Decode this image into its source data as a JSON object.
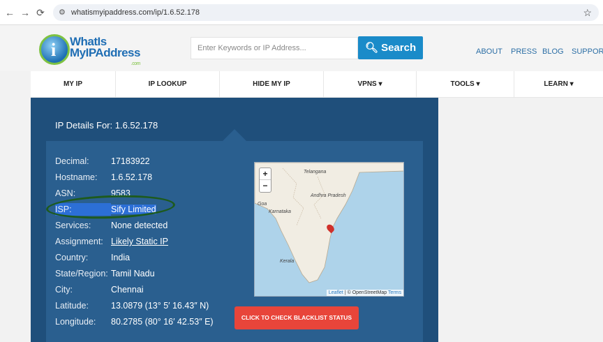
{
  "browser": {
    "url": "whatismyipaddress.com/ip/1.6.52.178",
    "back": "←",
    "forward": "→",
    "reload": "⟳"
  },
  "header": {
    "logo_line1": "WhatIs",
    "logo_line2": "MyIPAddress",
    "logo_domain": ".com",
    "search_placeholder": "Enter Keywords or IP Address...",
    "search_label": "Search",
    "links": [
      "ABOUT",
      "PRESS",
      "BLOG",
      "SUPPORT"
    ]
  },
  "menu": {
    "items": [
      "MY IP",
      "IP LOOKUP",
      "HIDE MY IP",
      "VPNS ▾",
      "TOOLS ▾",
      "LEARN ▾"
    ]
  },
  "details": {
    "title": "IP Details For: 1.6.52.178",
    "rows": [
      {
        "key": "Decimal:",
        "value": "17183922"
      },
      {
        "key": "Hostname:",
        "value": "1.6.52.178"
      },
      {
        "key": "ASN:",
        "value": "9583"
      },
      {
        "key": "ISP:",
        "value": "Sify Limited"
      },
      {
        "key": "Services:",
        "value": "None detected"
      },
      {
        "key": "Assignment:",
        "value": "Likely Static IP"
      },
      {
        "key": "Country:",
        "value": "India"
      },
      {
        "key": "State/Region:",
        "value": "Tamil Nadu"
      },
      {
        "key": "City:",
        "value": "Chennai"
      },
      {
        "key": "Latitude:",
        "value": "13.0879  (13° 5′ 16.43″ N)"
      },
      {
        "key": "Longitude:",
        "value": "80.2785  (80° 16′ 42.53″ E)"
      }
    ]
  },
  "map": {
    "zoom_in": "+",
    "zoom_out": "−",
    "labels": [
      "Telangana",
      "Andhra Pradesh",
      "Karnataka",
      "Goa",
      "Kerala"
    ],
    "attribution_leaflet": "Leaflet",
    "attribution_sep": " | © OpenStreetMap ",
    "attribution_terms": "Terms"
  },
  "blacklist_button": "CLICK TO CHECK BLACKLIST STATUS",
  "colors": {
    "panel": "#1f4f7b",
    "inner": "#2a5f8f",
    "search": "#1a8bc9",
    "blacklist": "#e8453a",
    "link": "#8fd16a"
  }
}
